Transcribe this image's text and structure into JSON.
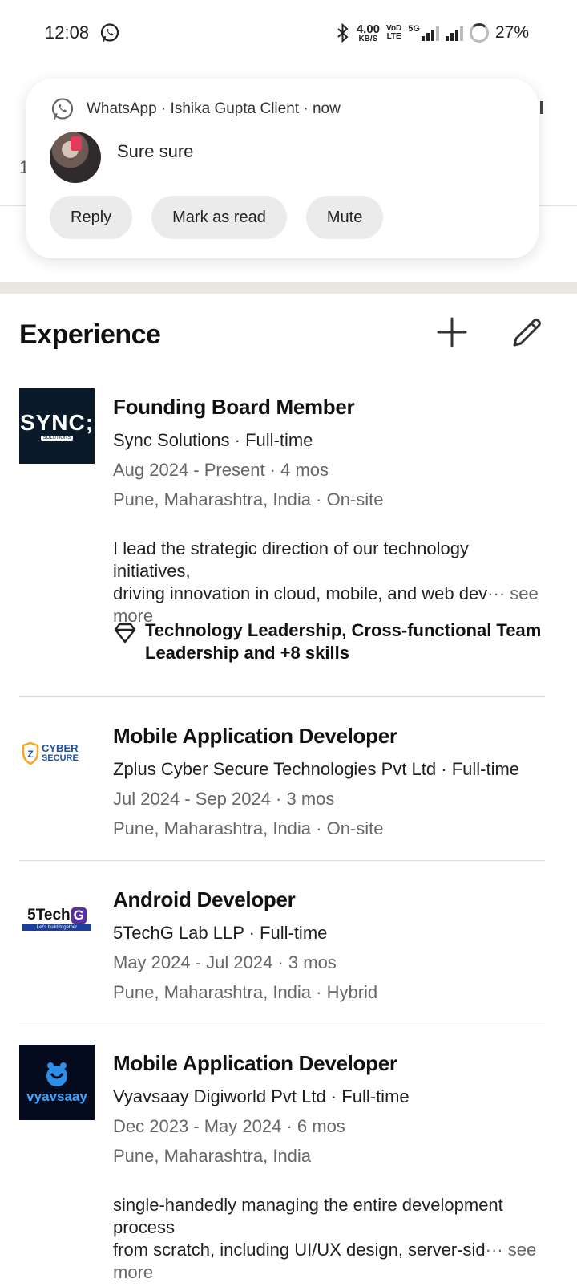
{
  "status_bar": {
    "time": "12:08",
    "net_speed": "4.00",
    "net_unit": "KB/S",
    "volte_top": "VoD",
    "volte_bottom": "LTE",
    "net_type": "5G",
    "battery": "27%"
  },
  "background": {
    "edge_digit": "1"
  },
  "notification": {
    "meta": "WhatsApp · Ishika Gupta Client · now",
    "message": "Sure sure",
    "actions": [
      "Reply",
      "Mark as read",
      "Mute"
    ]
  },
  "experience": {
    "title": "Experience",
    "entries": [
      {
        "logo_text": "SYNC;",
        "logo_sub": "SOLUTIONS",
        "title": "Founding Board Member",
        "company": "Sync Solutions · Full-time",
        "dates": "Aug 2024 - Present · 4 mos",
        "location": "Pune, Maharashtra, India · On-site",
        "desc_line1": "I lead the strategic direction of our technology initiatives,",
        "desc_line2": "driving innovation in cloud, mobile, and web dev",
        "see_more": "see more",
        "skills_line1": "Technology Leadership, Cross-functional Team",
        "skills_line2": "Leadership and +8 skills"
      },
      {
        "logo_text": "CYBER",
        "logo_sub": "SECURE",
        "title": "Mobile Application Developer",
        "company": "Zplus Cyber Secure Technologies Pvt Ltd · Full-time",
        "dates": "Jul 2024 - Sep 2024 · 3 mos",
        "location": "Pune, Maharashtra, India · On-site"
      },
      {
        "logo_text": "5Tech",
        "logo_mark": "G",
        "logo_sub": "Let's build together",
        "title": "Android Developer",
        "company": "5TechG Lab LLP · Full-time",
        "dates": "May 2024 - Jul 2024 · 3 mos",
        "location": "Pune, Maharashtra, India · Hybrid"
      },
      {
        "logo_text": "vyavsaay",
        "title": "Mobile Application Developer",
        "company": "Vyavsaay Digiworld Pvt Ltd · Full-time",
        "dates": "Dec 2023 - May 2024 · 6 mos",
        "location": "Pune, Maharashtra, India",
        "desc_line1": "single-handedly managing the entire development process",
        "desc_line2": "from scratch, including UI/UX design, server-sid",
        "see_more": "see more"
      }
    ]
  },
  "colors": {
    "sync_bg": "#0a1a2b",
    "cyber_orange": "#f5a623",
    "cyber_blue": "#1d4f9c",
    "tech_purple": "#5a2ea6",
    "vyav_bg": "#050b1e",
    "vyav_blue": "#3aa8ff"
  }
}
